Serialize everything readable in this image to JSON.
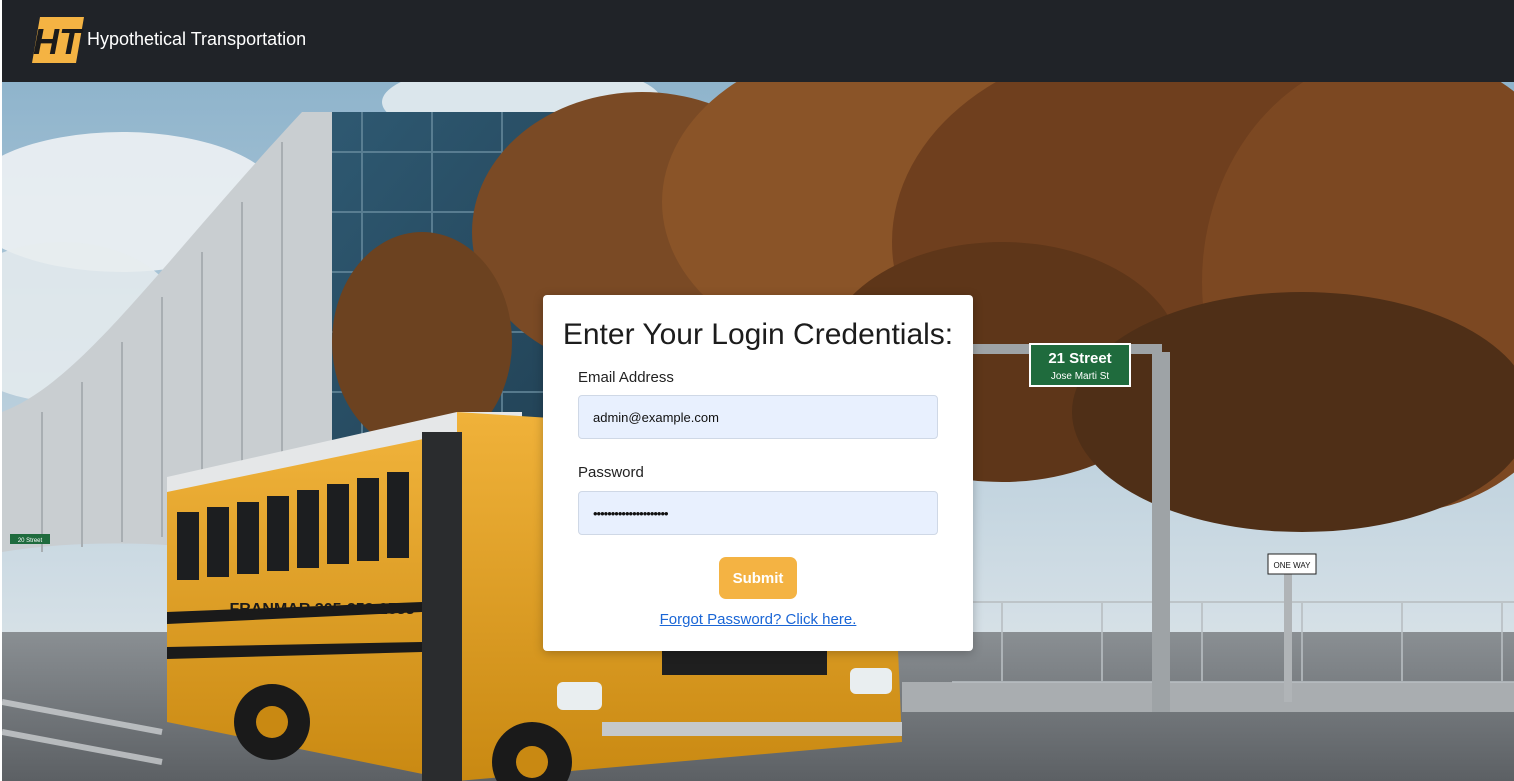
{
  "header": {
    "logo_text": "HT",
    "brand_name": "Hypothetical Transportation",
    "bg_color": "#202328",
    "logo_color": "#f4b343"
  },
  "hero": {
    "bus_lettering": "FRANMAR 305-253-2533",
    "street_sign_line1": "21 Street",
    "street_sign_line2": "Jose Marti St",
    "one_way_sign": "ONE WAY",
    "small_sign": "20 Street"
  },
  "login": {
    "title": "Enter Your Login Credentials:",
    "email_label": "Email Address",
    "email_value": "admin@example.com",
    "password_label": "Password",
    "password_value": "•••••••••••••••••••••",
    "submit_label": "Submit",
    "forgot_link": "Forgot Password? Click here.",
    "accent_color": "#f4b343",
    "link_color": "#1a66d6"
  }
}
